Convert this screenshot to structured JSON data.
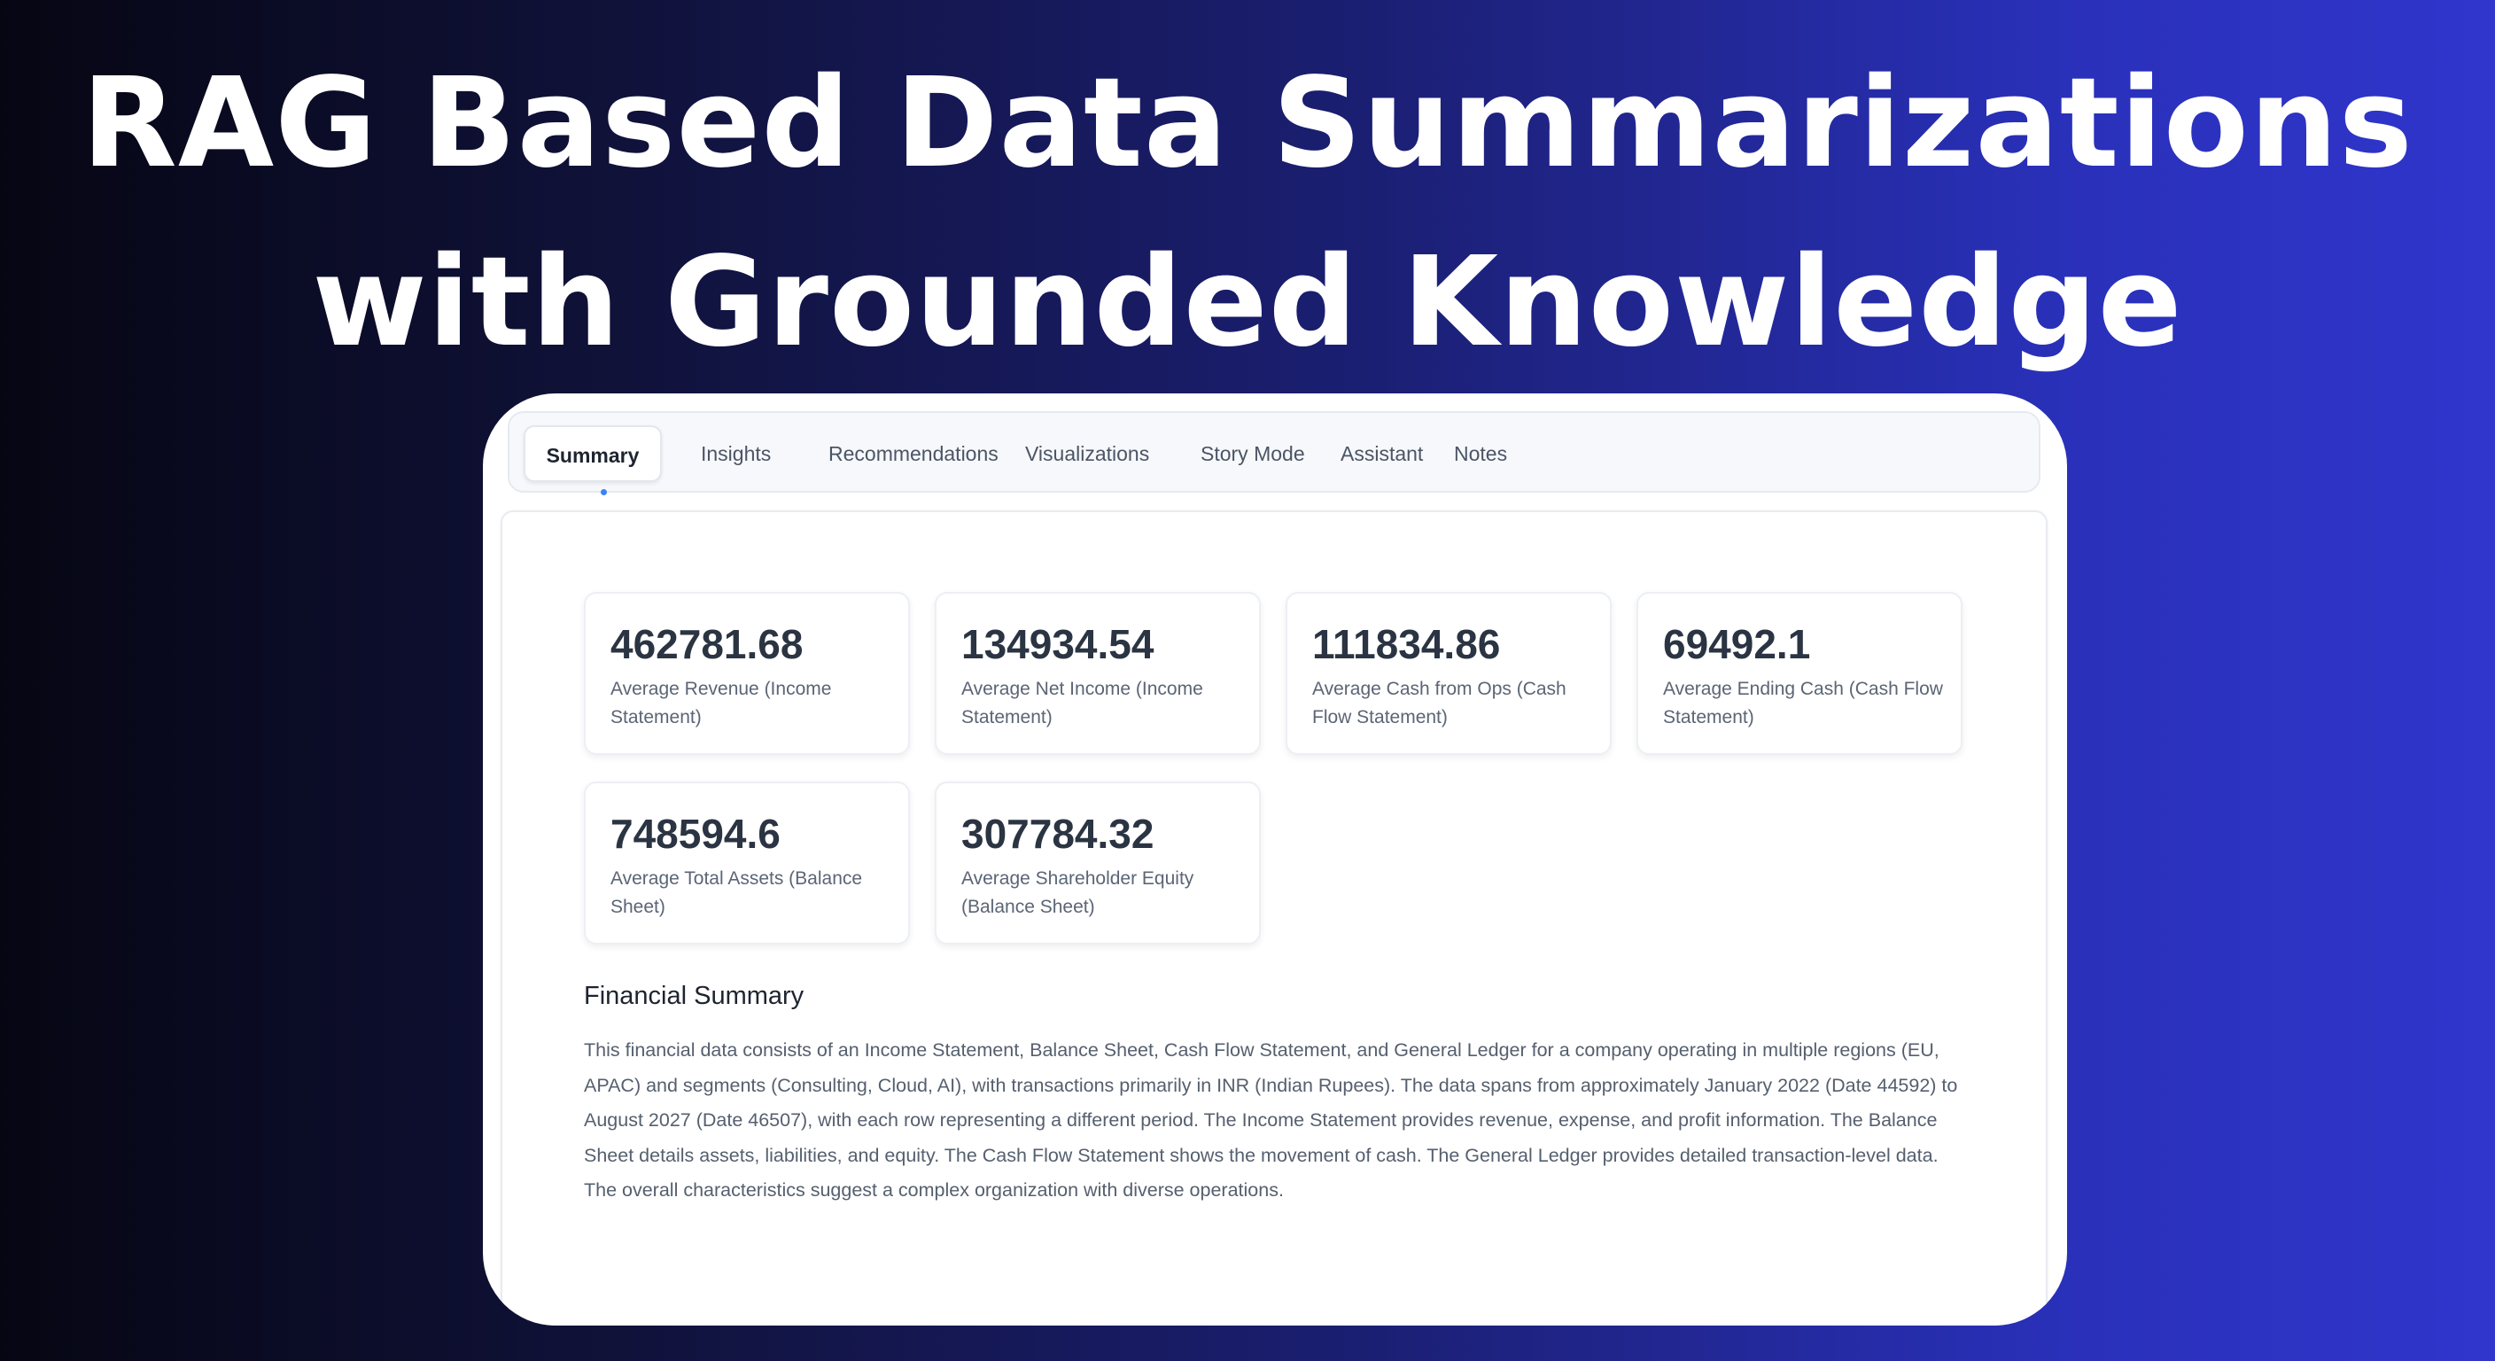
{
  "headline": {
    "line1": "RAG Based Data Summarizations",
    "line2": "with Grounded Knowledge"
  },
  "tabs": [
    {
      "label": "Summary",
      "active": true
    },
    {
      "label": "Insights",
      "active": false
    },
    {
      "label": "Recommendations",
      "active": false
    },
    {
      "label": "Visualizations",
      "active": false
    },
    {
      "label": "Story Mode",
      "active": false
    },
    {
      "label": "Assistant",
      "active": false
    },
    {
      "label": "Notes",
      "active": false
    }
  ],
  "metrics": [
    {
      "value": "462781.68",
      "label": "Average Revenue (Income Statement)"
    },
    {
      "value": "134934.54",
      "label": "Average Net Income (Income Statement)"
    },
    {
      "value": "111834.86",
      "label": "Average Cash from Ops (Cash Flow Statement)"
    },
    {
      "value": "69492.1",
      "label": "Average Ending Cash (Cash Flow Statement)"
    },
    {
      "value": "748594.6",
      "label": "Average Total Assets (Balance Sheet)"
    },
    {
      "value": "307784.32",
      "label": "Average Shareholder Equity (Balance Sheet)"
    }
  ],
  "summary": {
    "title": "Financial Summary",
    "text": "This financial data consists of an Income Statement, Balance Sheet, Cash Flow Statement, and General Ledger for a company operating in multiple regions (EU, APAC) and segments (Consulting, Cloud, AI), with transactions primarily in INR (Indian Rupees). The data spans from approximately January 2022 (Date 44592) to August 2027 (Date 46507), with each row representing a different period. The Income Statement provides revenue, expense, and profit information. The Balance Sheet details assets, liabilities, and equity. The Cash Flow Statement shows the movement of cash. The General Ledger provides detailed transaction-level data. The overall characteristics suggest a complex organization with diverse operations."
  },
  "colors": {
    "accent": "#3b82f6",
    "background_start": "#060613",
    "background_end": "#3035cc"
  }
}
